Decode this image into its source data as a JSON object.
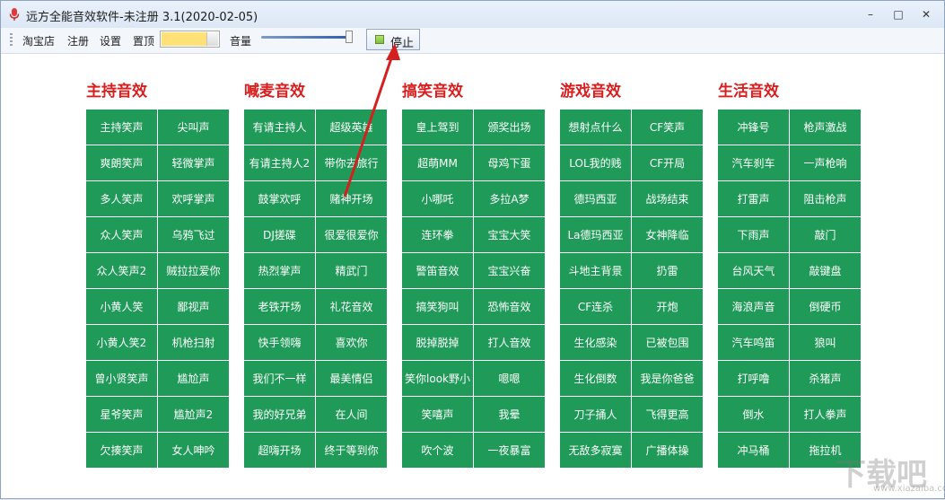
{
  "window": {
    "title": "远方全能音效软件-未注册 3.1(2020-02-05)",
    "minimize": "–",
    "maximize": "□",
    "close": "✕"
  },
  "toolbar": {
    "items": [
      "淘宝店",
      "注册",
      "设置",
      "置顶"
    ],
    "color_swatch": "#ffe177",
    "volume_label": "音量",
    "stop_label": "停止"
  },
  "groups": [
    {
      "title": "主持音效",
      "cells": [
        "主持笑声",
        "尖叫声",
        "爽朗笑声",
        "轻微掌声",
        "多人笑声",
        "欢呼掌声",
        "众人笑声",
        "乌鸦飞过",
        "众人笑声2",
        "贼拉拉爱你",
        "小黄人笑",
        "鄙视声",
        "小黄人笑2",
        "机枪扫射",
        "曾小贤笑声",
        "尴尬声",
        "星爷笑声",
        "尴尬声2",
        "欠揍笑声",
        "女人呻吟"
      ]
    },
    {
      "title": "喊麦音效",
      "cells": [
        "有请主持人",
        "超级英雄",
        "有请主持人2",
        "带你去旅行",
        "鼓掌欢呼",
        "赌神开场",
        "DJ搓碟",
        "很爱很爱你",
        "热烈掌声",
        "精武门",
        "老铁开场",
        "礼花音效",
        "快手领嗨",
        "喜欢你",
        "我们不一样",
        "最美情侣",
        "我的好兄弟",
        "在人间",
        "超嗨开场",
        "终于等到你"
      ]
    },
    {
      "title": "搞笑音效",
      "cells": [
        "皇上驾到",
        "颁奖出场",
        "超萌MM",
        "母鸡下蛋",
        "小哪吒",
        "多拉A梦",
        "连环拳",
        "宝宝大笑",
        "警笛音效",
        "宝宝兴奋",
        "搞笑狗叫",
        "恐怖音效",
        "脱掉脱掉",
        "打人音效",
        "笑你look野小",
        "嗯嗯",
        "笑嘻声",
        "我晕",
        "吹个波",
        "一夜暴富"
      ]
    },
    {
      "title": "游戏音效",
      "cells": [
        "想射点什么",
        "CF笑声",
        "LOL我的贱",
        "CF开局",
        "德玛西亚",
        "战场结束",
        "La德玛西亚",
        "女神降临",
        "斗地主背景",
        "扔雷",
        "CF连杀",
        "开炮",
        "生化感染",
        "已被包围",
        "生化倒数",
        "我是你爸爸",
        "刀子捅人",
        "飞得更高",
        "无敌多寂寞",
        "广播体操"
      ]
    },
    {
      "title": "生活音效",
      "cells": [
        "冲锋号",
        "枪声激战",
        "汽车刹车",
        "一声枪响",
        "打雷声",
        "阻击枪声",
        "下雨声",
        "敲门",
        "台风天气",
        "敲键盘",
        "海浪声音",
        "倒硬币",
        "汽车鸣笛",
        "狼叫",
        "打呼噜",
        "杀猪声",
        "倒水",
        "打人拳声",
        "冲马桶",
        "拖拉机"
      ]
    }
  ],
  "watermark": {
    "logo": "下载吧",
    "sub": "www.xiazaiba.com"
  }
}
